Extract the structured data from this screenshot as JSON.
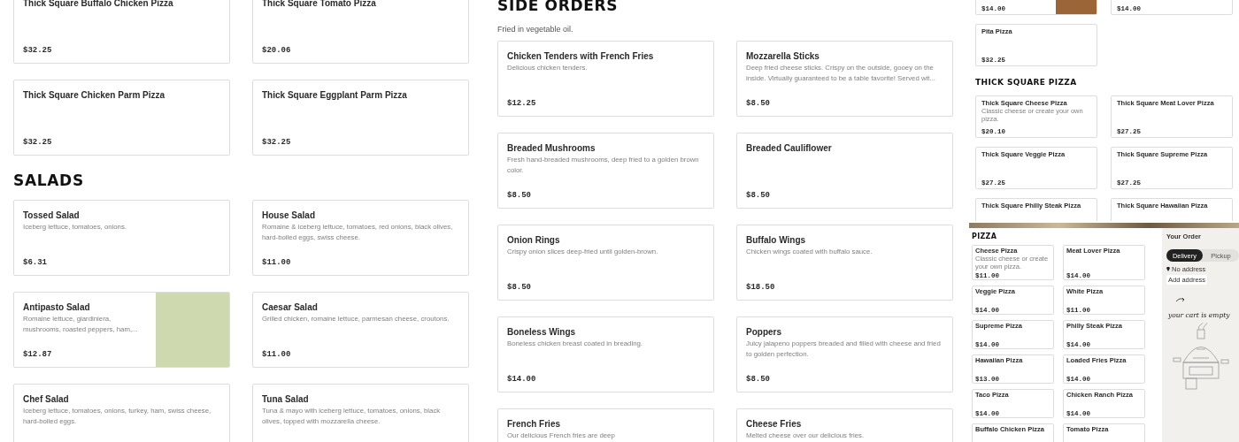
{
  "screens": [
    {
      "kind": "menu",
      "sections": [
        {
          "cards": [
            {
              "name": "Thick Square Buffalo Chicken Pizza",
              "price": "$32.25"
            },
            {
              "name": "Thick Square Tomato Pizza",
              "price": "$20.06"
            },
            {
              "name": "Thick Square Chicken Parm Pizza",
              "price": "$32.25"
            },
            {
              "name": "Thick Square Eggplant Parm Pizza",
              "price": "$32.25"
            }
          ]
        },
        {
          "heading": "SALADS",
          "cards": [
            {
              "name": "Tossed Salad",
              "description": "Iceberg lettuce, tomatoes, onions.",
              "price": "$6.31"
            },
            {
              "name": "House Salad",
              "description": "Romaine & iceberg lettuce, tomatoes, red onions, black olives, hard-boiled eggs, swiss cheese.",
              "price": "$11.00"
            },
            {
              "name": "Antipasto Salad",
              "description": "Romaine lettuce, giardiniera, mushrooms, roasted peppers, ham,...",
              "price": "$12.87",
              "photo": true
            },
            {
              "name": "Caesar Salad",
              "description": "Grilled chicken, romaine lettuce, parmesan cheese, croutons.",
              "price": "$11.00"
            },
            {
              "name": "Chef Salad",
              "description": "Iceberg lettuce, tomatoes, onions, turkey, ham, swiss cheese, hard-boiled eggs."
            },
            {
              "name": "Tuna Salad",
              "description": "Tuna & mayo with iceberg lettuce, tomatoes, onions, black olives, topped with mozzarella cheese."
            }
          ]
        }
      ]
    },
    {
      "kind": "menu",
      "sections": [
        {
          "heading": "SIDE ORDERS",
          "note": "Fried in vegetable oil.",
          "cards": [
            {
              "name": "Chicken Tenders with French Fries",
              "description": "Delicious chicken tenders.",
              "price": "$12.25"
            },
            {
              "name": "Mozzarella Sticks",
              "description": "Deep fried cheese sticks. Crispy on the outside, gooey on the inside. Virtually guaranteed to be a table favorite! Served wit...",
              "price": "$8.50"
            },
            {
              "name": "Breaded Mushrooms",
              "description": "Fresh hand-breaded mushrooms, deep fried to a golden brown color.",
              "price": "$8.50"
            },
            {
              "name": "Breaded Cauliflower",
              "price": "$8.50"
            },
            {
              "name": "Onion Rings",
              "description": "Crispy onion slices deep-fried until golden-brown.",
              "price": "$8.50"
            },
            {
              "name": "Buffalo Wings",
              "description": "Chicken wings coated with buffalo sauce.",
              "price": "$18.50"
            },
            {
              "name": "Boneless Wings",
              "description": "Boneless chicken breast coated in breading.",
              "price": "$14.00"
            },
            {
              "name": "Poppers",
              "description": "Juicy jalapeno poppers breaded and filled with cheese and fried to golden perfection.",
              "price": "$8.50"
            },
            {
              "name": "French Fries",
              "description": "Our delicious French fries are deep"
            },
            {
              "name": "Cheese Fries",
              "description": "Melted cheese over our delicious fries."
            }
          ]
        }
      ]
    },
    {
      "kind": "mini-menu",
      "sections": [
        {
          "cards": [
            {
              "price": "$14.00",
              "photo": true
            },
            {
              "price": "$14.00"
            },
            {
              "name": "Pita Pizza",
              "price": "$32.25"
            }
          ]
        },
        {
          "heading": "THICK SQUARE PIZZA",
          "cards": [
            {
              "name": "Thick Square Cheese Pizza",
              "description": "Classic cheese or create your own pizza.",
              "price": "$20.10"
            },
            {
              "name": "Thick Square Meat Lover Pizza",
              "price": "$27.25"
            },
            {
              "name": "Thick Square Veggie Pizza",
              "price": "$27.25"
            },
            {
              "name": "Thick Square Supreme Pizza",
              "price": "$27.25"
            },
            {
              "name": "Thick Square Philly Steak Pizza"
            },
            {
              "name": "Thick Square Hawaiian Pizza"
            }
          ]
        }
      ]
    },
    {
      "kind": "mini-store",
      "banner": true,
      "sections": [
        {
          "heading": "PIZZA",
          "cards": [
            {
              "name": "Cheese Pizza",
              "description": "Classic cheese or create your own pizza.",
              "price": "$11.00"
            },
            {
              "name": "Meat Lover Pizza",
              "price": "$14.00"
            },
            {
              "name": "Veggie Pizza",
              "price": "$14.00"
            },
            {
              "name": "White Pizza",
              "price": "$11.00"
            },
            {
              "name": "Supreme Pizza",
              "price": "$14.00"
            },
            {
              "name": "Philly Steak Pizza",
              "price": "$14.00"
            },
            {
              "name": "Hawaiian Pizza",
              "price": "$13.00"
            },
            {
              "name": "Loaded Fries Pizza",
              "price": "$14.00"
            },
            {
              "name": "Taco Pizza",
              "price": "$14.00"
            },
            {
              "name": "Chicken Ranch Pizza",
              "price": "$14.00"
            },
            {
              "name": "Buffalo Chicken Pizza"
            },
            {
              "name": "Tomato Pizza"
            }
          ]
        }
      ],
      "order": {
        "title": "Your Order",
        "modes": [
          {
            "label": "Delivery",
            "selected": true
          },
          {
            "label": "Pickup",
            "selected": false
          }
        ],
        "address": "No address",
        "address_button": "Add address",
        "empty_message": "your cart is empty"
      }
    }
  ]
}
